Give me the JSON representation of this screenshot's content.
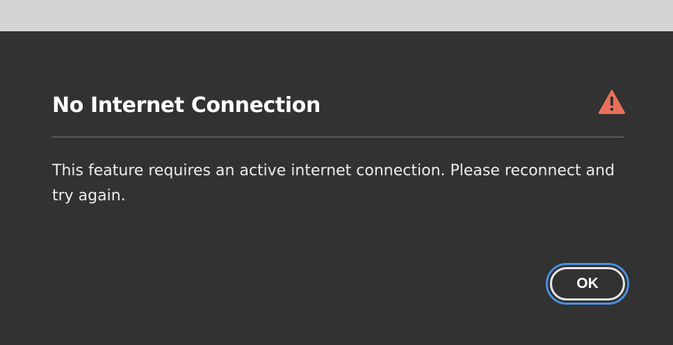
{
  "dialog": {
    "title": "No Internet Connection",
    "message": "This feature requires an active internet connection. Please reconnect and try again.",
    "icon": "warning-icon",
    "icon_color": "#e8705a",
    "ok_label": "OK"
  },
  "colors": {
    "background": "#323232",
    "top_strip": "#d4d4d4",
    "focus_ring": "#4a90e2",
    "text": "#ffffff"
  }
}
